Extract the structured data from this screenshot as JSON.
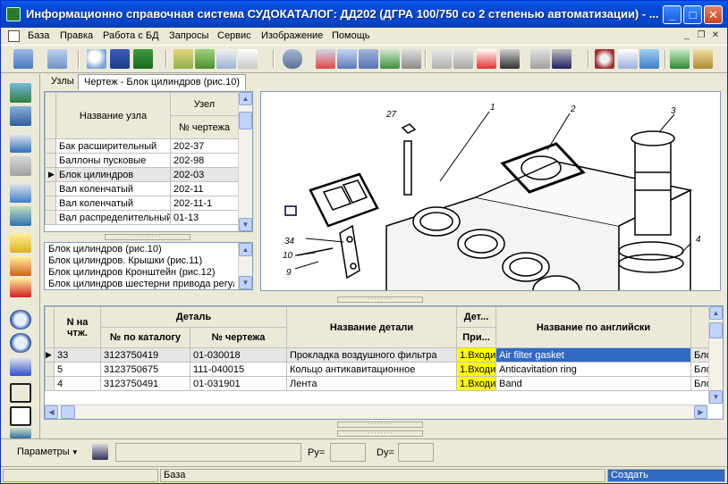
{
  "window": {
    "title": "Информационно справочная система СУДОКАТАЛОГ: ДД202 (ДГРА 100/750 со 2 степенью автоматизации) - ..."
  },
  "menu": [
    "База",
    "Правка",
    "Работа с БД",
    "Запросы",
    "Сервис",
    "Изображение",
    "Помощь"
  ],
  "tabs": [
    {
      "label": "Узлы",
      "active": false
    },
    {
      "label": "Чертеж - Блок цилиндров (рис.10)",
      "active": true
    }
  ],
  "nodes_table": {
    "header_name": "Название узла",
    "header_group": "Узел",
    "header_drawing": "№ чертежа",
    "rows": [
      {
        "name": "Бак расширительный",
        "drawing": "202-37",
        "selected": false
      },
      {
        "name": "Баллоны пусковые",
        "drawing": "202-98",
        "selected": false
      },
      {
        "name": "Блок цилиндров",
        "drawing": "202-03",
        "selected": true
      },
      {
        "name": "Вал коленчатый",
        "drawing": "202-11",
        "selected": false
      },
      {
        "name": "Вал коленчатый",
        "drawing": "202-11-1",
        "selected": false
      },
      {
        "name": "Вал распределительный",
        "drawing": "01-13",
        "selected": false
      }
    ]
  },
  "figures_list": [
    "Блок цилиндров  (рис.10)",
    "Блок цилиндров. Крышки (рис.11)",
    "Блок цилиндров  Кронштейн (рис.12)",
    "Блок цилиндров шестерни привода регул"
  ],
  "drawing_callouts": [
    "27",
    "1",
    "2",
    "3",
    "34",
    "10",
    "9",
    "4"
  ],
  "parts_table": {
    "col_num": "N на чтж.",
    "col_detail_group": "Деталь",
    "col_catalog": "№ по каталогу",
    "col_drawing": "№ чертежа",
    "col_name": "Название детали",
    "col_det": "Дет...",
    "col_det_sub": "При...",
    "col_english": "Название по английски",
    "rows": [
      {
        "num": "33",
        "catalog": "3123750419",
        "drawing": "01-030018",
        "name": "Прокладка воздушного фильтра",
        "status": "1.Входи",
        "english": "Air filter gasket",
        "extra": "Бло",
        "selected": true
      },
      {
        "num": "5",
        "catalog": "3123750675",
        "drawing": "111-040015",
        "name": "Кольцо антикавитационное",
        "status": "1.Входи",
        "english": "Anticavitation ring",
        "extra": "Бло",
        "selected": false
      },
      {
        "num": "4",
        "catalog": "3123750491",
        "drawing": "01-031901",
        "name": "Лента",
        "status": "1.Входи",
        "english": "Band",
        "extra": "Бло",
        "selected": false
      }
    ]
  },
  "params": {
    "label": "Параметры",
    "py_label": "Py=",
    "dy_label": "Dy="
  },
  "status": {
    "db": "База",
    "action": "Создать"
  },
  "colors": {
    "title_bar": "#0548d6",
    "selection": "#316ac5",
    "status_highlight": "#ffff00"
  }
}
